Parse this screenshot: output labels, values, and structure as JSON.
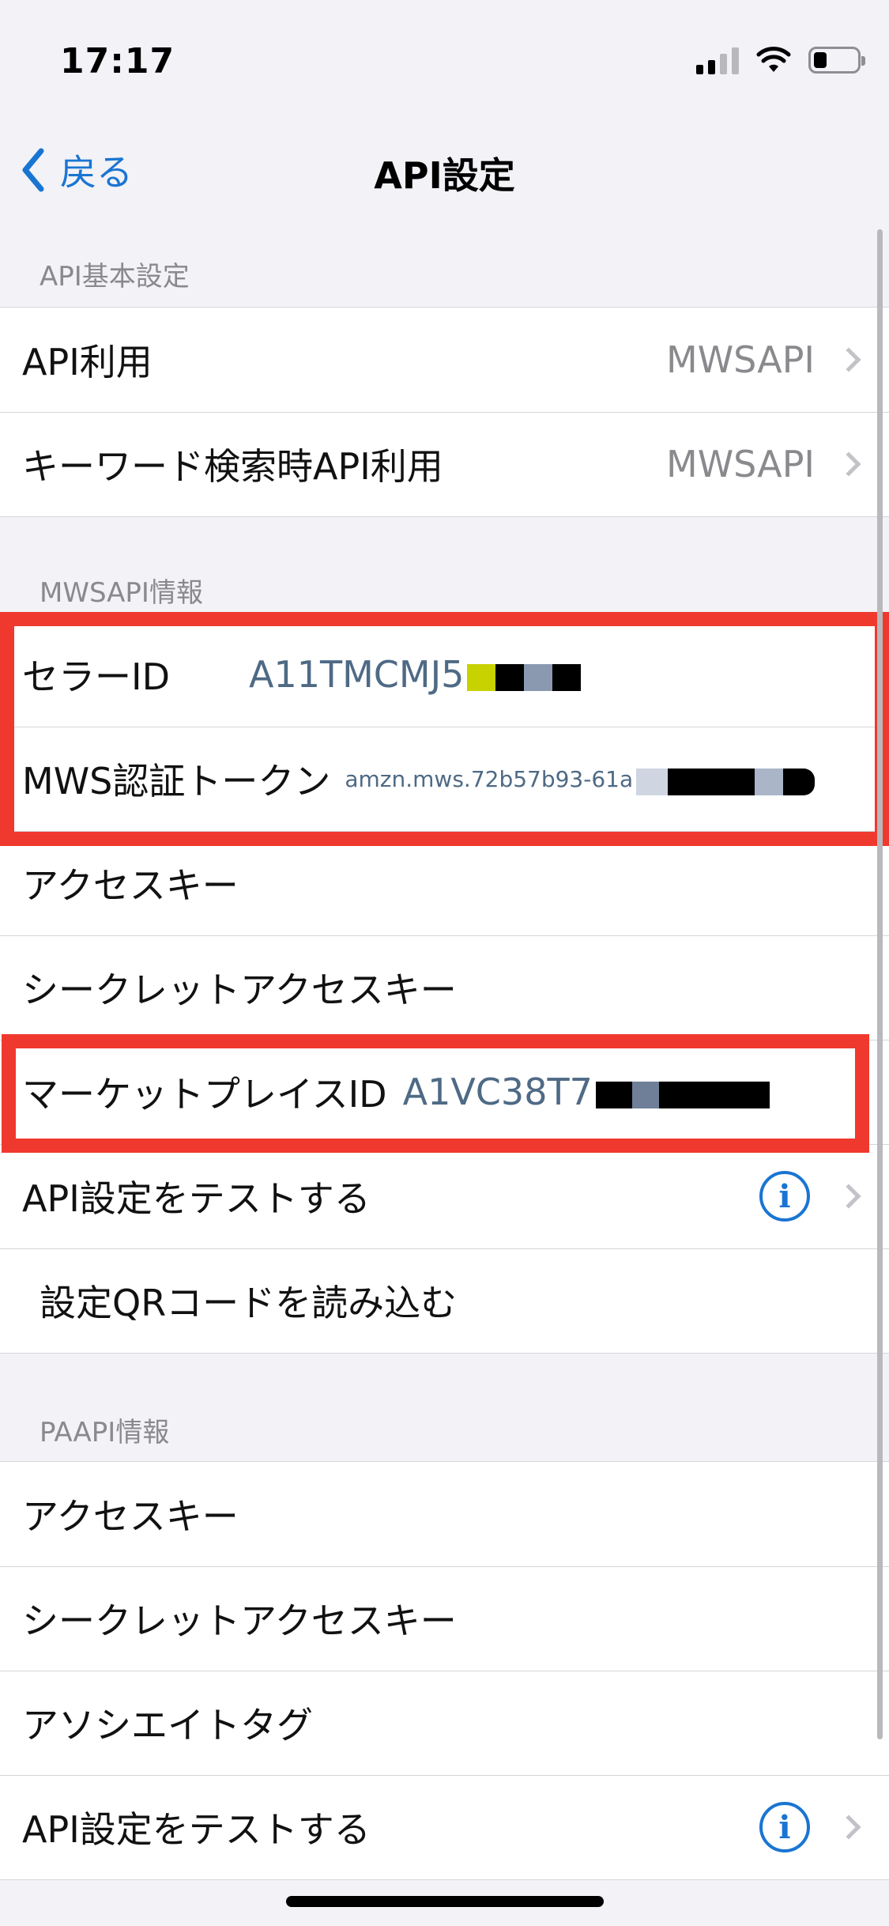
{
  "status_bar": {
    "time": "17:17"
  },
  "nav": {
    "back_label": "戻る",
    "title": "API設定"
  },
  "section_basic": {
    "header": "API基本設定",
    "rows": [
      {
        "label": "API利用",
        "value": "MWSAPI"
      },
      {
        "label": "キーワード検索時API利用",
        "value": "MWSAPI"
      }
    ]
  },
  "section_mws": {
    "header": "MWSAPI情報",
    "seller_id": {
      "label": "セラーID",
      "value": "A11TMCMJ5"
    },
    "mws_token": {
      "label": "MWS認証トークン",
      "value": "amzn.mws.72b57b93-61a"
    },
    "access_key": {
      "label": "アクセスキー"
    },
    "secret_key": {
      "label": "シークレットアクセスキー"
    },
    "marketplace": {
      "label": "マーケットプレイスID",
      "value": "A1VC38T7"
    },
    "test_api": {
      "label": "API設定をテストする"
    },
    "read_qr": {
      "label": "設定QRコードを読み込む"
    }
  },
  "section_paapi": {
    "header": "PAAPI情報",
    "access_key": {
      "label": "アクセスキー"
    },
    "secret_key": {
      "label": "シークレットアクセスキー"
    },
    "associate_tag": {
      "label": "アソシエイトタグ"
    },
    "test_api": {
      "label": "API設定をテストする"
    }
  },
  "colors": {
    "accent": "#1a75d2",
    "highlight": "#f0392e",
    "value_blue": "#4e6a85"
  }
}
